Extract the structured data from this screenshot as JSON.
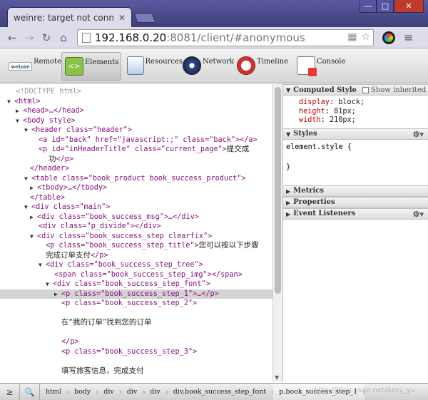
{
  "browser": {
    "tab_title": "weinre: target not conn",
    "url_host": "192.168.0.20",
    "url_rest": ":8081/client/#anonymous",
    "window_buttons": [
      "—",
      "□",
      "✕"
    ]
  },
  "panels": [
    {
      "label": "Remote",
      "icon": "weinre-icon"
    },
    {
      "label": "Elements",
      "icon": "elements-icon"
    },
    {
      "label": "Resources",
      "icon": "resources-icon"
    },
    {
      "label": "Network",
      "icon": "network-icon"
    },
    {
      "label": "Timeline",
      "icon": "timeline-icon"
    },
    {
      "label": "Console",
      "icon": "console-icon"
    }
  ],
  "dom": {
    "doctype": "<!DOCTYPE html>",
    "html_open": "<html>",
    "head": "<head>…</head>",
    "body_open": "<body style>",
    "header_open": "<header class=\"header\">",
    "a_back": "<a id=\"back\" href=\"javascript:;\" class=\"back\"></a>",
    "p_title_open": "<p id=\"inHeaderTitle\" class=\"current_page\">",
    "p_title_text": "提交成",
    "p_title_text2": "功",
    "p_close": "</p>",
    "header_close": "</header>",
    "table_open": "<table class=\"book_product book_success_product\">",
    "tbody": "<tbody>…</tbody>",
    "table_close": "</table>",
    "main_open": "<div class=\"main\">",
    "msg_div": "<div class=\"book_success_msg\">…</div>",
    "divide_div": "<div class=\"p_divide\"></div>",
    "step_div": "<div class=\"book_success_step clearfix\">",
    "step_title_p": "<p class=\"book_success_step_title\">",
    "step_title_text": "您可以按以下步骤",
    "step_title_text2": "完成订单支付",
    "step_tree_div": "<div class=\"book_success_step_tree\">",
    "step_img_span": "<span class=\"book_success_step_img\"></span>",
    "step_font_div": "<div class=\"book_success_step_font\">",
    "step1_p": "<p class=\"book_success_step_1\">…</p>",
    "step2_p": "<p class=\"book_success_step_2\">",
    "step2_text": "在“我的订单”找到您的订单",
    "step2_close": "</p>",
    "step3_p": "<p class=\"book_success_step_3\">",
    "step3_text": "填写旅客信息，完成支付"
  },
  "sidebar": {
    "computed_style_title": "Computed Style",
    "show_inherited": "Show inherited",
    "computed": [
      {
        "prop": "display",
        "val": "block;"
      },
      {
        "prop": "height",
        "val": "81px;"
      },
      {
        "prop": "width",
        "val": "210px;"
      }
    ],
    "styles_title": "Styles",
    "element_style_open": "element.style {",
    "element_style_close": "}",
    "metrics_title": "Metrics",
    "properties_title": "Properties",
    "event_listeners_title": "Event Listeners"
  },
  "breadcrumbs": [
    "html",
    "body",
    "div",
    "div",
    "div",
    "div.book_success_step_font",
    "p.book_success_step_1"
  ],
  "watermark": "http://blog.csdn.net/Amy_yu"
}
